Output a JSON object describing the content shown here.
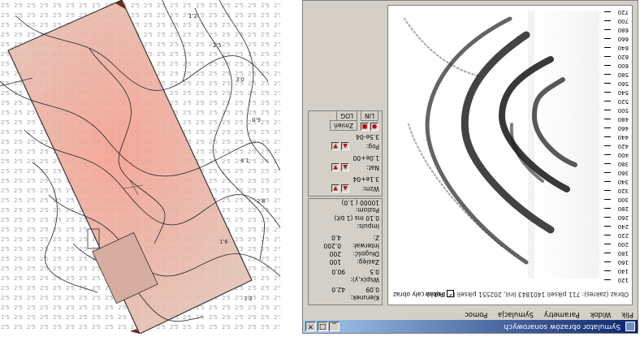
{
  "left_map": {
    "contour_labels": [
      "1'2",
      "2'5",
      "3'0",
      "0'9",
      "4'1",
      "2'8",
      "1'6",
      "3'3"
    ]
  },
  "window": {
    "title": "Symulator obrazów sonarowych",
    "menu": [
      "Plik",
      "Widok",
      "Parametry",
      "Symulacja",
      "Pomoc"
    ]
  },
  "viewport": {
    "status": "Obraz (zakres): 711 pikseli 1401843 linii, 202551 pikseli 88 bajtów",
    "full_view_label": "Pokaż cały obraz",
    "scale": [
      "120",
      "140",
      "160",
      "180",
      "200",
      "220",
      "240",
      "260",
      "280",
      "300",
      "320",
      "340",
      "360",
      "380",
      "400",
      "420",
      "440",
      "460",
      "480",
      "500",
      "520",
      "540",
      "560",
      "580",
      "600",
      "620",
      "640",
      "660",
      "680",
      "700",
      "720"
    ]
  },
  "panel": {
    "kierunek_label": "Kierunek:",
    "kierunek_vals": [
      "0.09",
      "42.0"
    ],
    "wspolrz_label": "Wsp(x,y):",
    "wspolrz_vals": [
      "0.5",
      "90.0"
    ],
    "zasieg_label": "Zasięg:",
    "zasieg_val": "100",
    "dlugosc_label": "Długość:",
    "dlugosc_val": "200",
    "interwal_label": "Interwał:",
    "interwal_val": "0.200",
    "z_label": "Z:",
    "z_val": "4.0",
    "impuls_label": "Impuls:",
    "impuls_val": "0.10 ms (1 bit)",
    "poziom_label": "Poziom:",
    "poziom_val": "10000 ( 1.0)",
    "wzm_label": "Wzm:",
    "wzm_val": "3.1e+04",
    "nat_label": "Nat:",
    "nat_val": "1.0e+00",
    "pog_label": "Pog:",
    "pog_val": "3.5e-04",
    "tabs": [
      "LIN",
      "LOG"
    ],
    "zmien_label": "Zmień"
  }
}
